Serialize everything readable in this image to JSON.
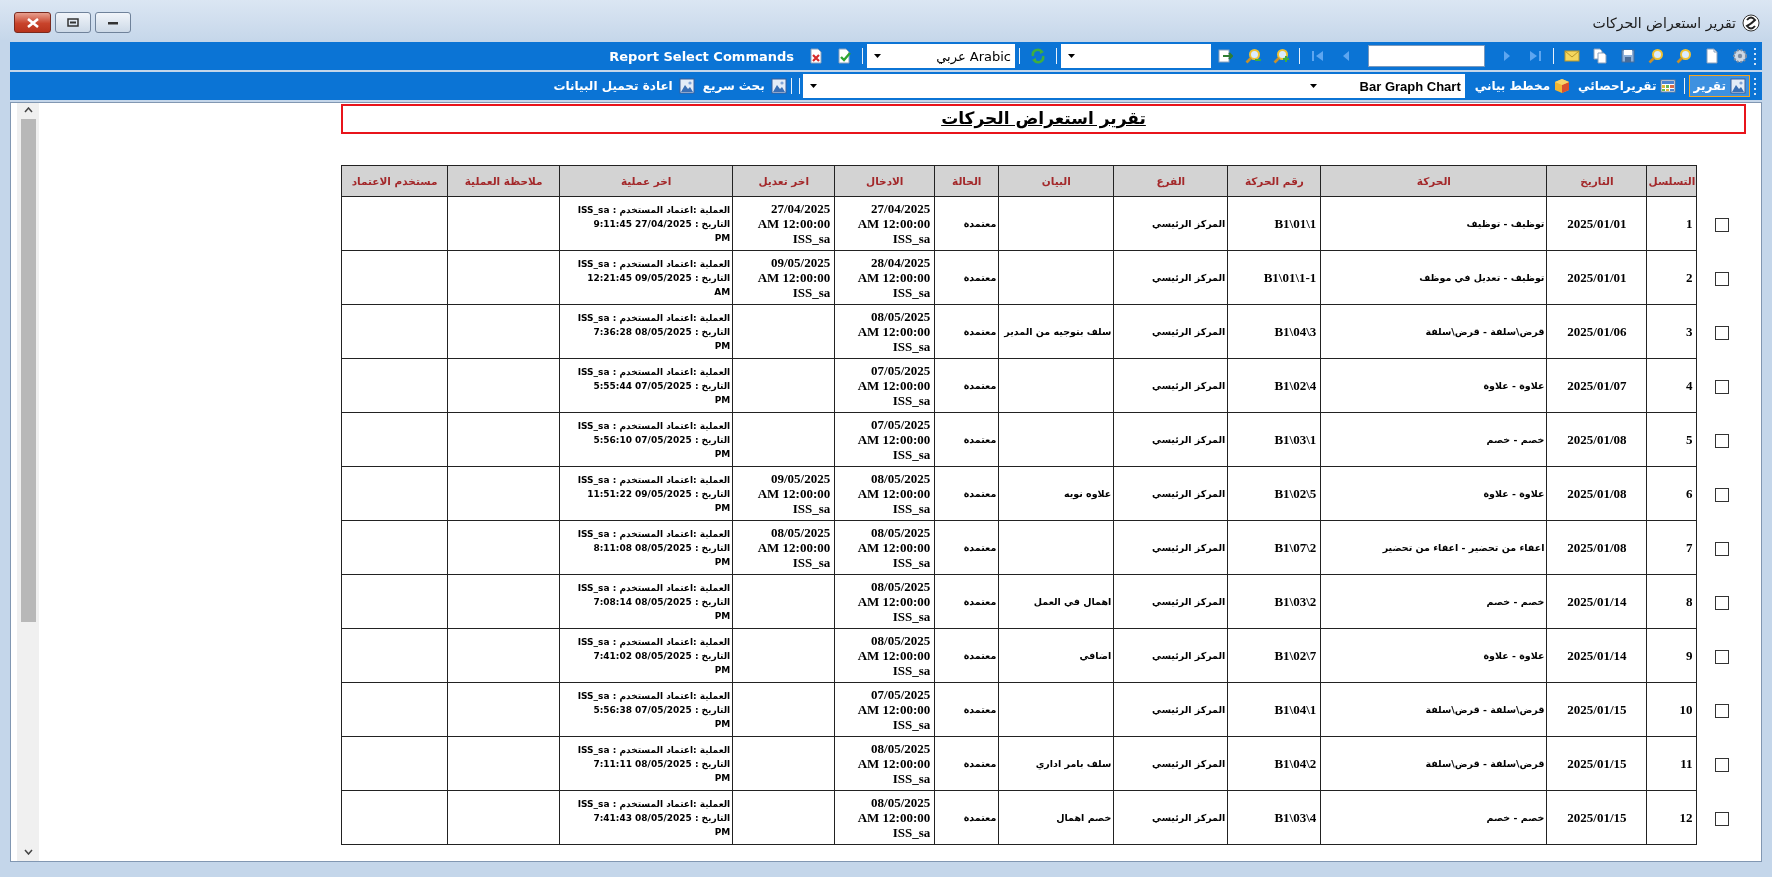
{
  "window": {
    "title": "تقرير استعراض الحركات"
  },
  "toolbar_1": {
    "label": "Report Select Commands",
    "language": "Arabic عربي"
  },
  "toolbar_2": {
    "tabs": [
      {
        "label": "تقرير",
        "selected": true
      },
      {
        "label": "تقريراحصائي",
        "selected": false
      },
      {
        "label": "مخطط بياني",
        "selected": false
      }
    ],
    "chart_type": "Bar Graph Chart",
    "actions": [
      "بحث سريع",
      "اعادة تحميل البيانات"
    ]
  },
  "report": {
    "title": "تقرير استعراض الحركات",
    "columns": [
      "التسلسل",
      "التاريخ",
      "الحركة",
      "رقم الحركة",
      "الفرع",
      "البيان",
      "الحالة",
      "الادخال",
      "اخر تعديل",
      "اخر عملية",
      "ملاحظة العملية",
      "مستخدم الاعتماد"
    ],
    "rows": [
      {
        "checked": false,
        "seq": "1",
        "date": "2025/01/01",
        "movement": "توظيف - توظيف",
        "number": "B1\\01\\1",
        "branch": "المركز الرئيسي",
        "status": "معتمدة",
        "entry": "27/04/2025\nAM 12:00:00\nISS_sa",
        "modified": "27/04/2025\nAM 12:00:00\nISS_sa",
        "last_operation": "العملية :اعتماد المستخدم : ISS_sa\nالتاريخ : 27/04/2025 9:11:45\nPM"
      },
      {
        "checked": false,
        "seq": "2",
        "date": "2025/01/01",
        "movement": "توظيف - تعديل في  موظف",
        "number": "B1\\01\\1-1",
        "branch": "المركز الرئيسي",
        "status": "معتمدة",
        "entry": "28/04/2025\nAM 12:00:00\nISS_sa",
        "modified": "09/05/2025\nAM 12:00:00\nISS_sa",
        "last_operation": "العملية :اعتماد المستخدم : ISS_sa\nالتاريخ : 09/05/2025 12:21:45\nAM"
      },
      {
        "checked": false,
        "seq": "3",
        "date": "2025/01/06",
        "movement": "قرض\\سلفة - قرض\\سلفة",
        "number": "B1\\04\\3",
        "branch": "المركز الرئيسي",
        "statement": "سلف بتوجيه من المدير",
        "status": "معتمدة",
        "entry": "08/05/2025\nAM 12:00:00\nISS_sa",
        "last_operation": "العملية :اعتماد المستخدم : ISS_sa\nالتاريخ : 08/05/2025 7:36:28\nPM"
      },
      {
        "checked": false,
        "seq": "4",
        "date": "2025/01/07",
        "movement": "علاوة - علاوة",
        "number": "B1\\02\\4",
        "branch": "المركز الرئيسي",
        "status": "معتمدة",
        "entry": "07/05/2025\nAM 12:00:00\nISS_sa",
        "last_operation": "العملية :اعتماد المستخدم : ISS_sa\nالتاريخ : 07/05/2025 5:55:44\nPM"
      },
      {
        "checked": false,
        "seq": "5",
        "date": "2025/01/08",
        "movement": "خصم - خصم",
        "number": "B1\\03\\1",
        "branch": "المركز الرئيسي",
        "status": "معتمدة",
        "entry": "07/05/2025\nAM 12:00:00\nISS_sa",
        "last_operation": "العملية :اعتماد المستخدم : ISS_sa\nالتاريخ : 07/05/2025 5:56:10\nPM"
      },
      {
        "checked": false,
        "seq": "6",
        "date": "2025/01/08",
        "movement": "علاوة - علاوة",
        "number": "B1\\02\\5",
        "branch": "المركز الرئيسي",
        "statement": "علاوه نويه",
        "status": "معتمدة",
        "entry": "08/05/2025\nAM 12:00:00\nISS_sa",
        "modified": "09/05/2025\nAM 12:00:00\nISS_sa",
        "last_operation": "العملية :اعتماد المستخدم : ISS_sa\nالتاريخ : 09/05/2025 11:51:22\nPM"
      },
      {
        "checked": false,
        "seq": "7",
        "date": "2025/01/08",
        "movement": "اعفاء من تحضير - اعفاء من تحضير",
        "number": "B1\\07\\2",
        "branch": "المركز الرئيسي",
        "status": "معتمدة",
        "entry": "08/05/2025\nAM 12:00:00\nISS_sa",
        "modified": "08/05/2025\nAM 12:00:00\nISS_sa",
        "last_operation": "العملية :اعتماد المستخدم : ISS_sa\nالتاريخ : 08/05/2025 8:11:08\nPM"
      },
      {
        "checked": false,
        "seq": "8",
        "date": "2025/01/14",
        "movement": "خصم - خصم",
        "number": "B1\\03\\2",
        "branch": "المركز الرئيسي",
        "statement": "اهمال في العمل",
        "status": "معتمدة",
        "entry": "08/05/2025\nAM 12:00:00\nISS_sa",
        "last_operation": "العملية :اعتماد المستخدم : ISS_sa\nالتاريخ : 08/05/2025 7:08:14\nPM"
      },
      {
        "checked": false,
        "seq": "9",
        "date": "2025/01/14",
        "movement": "علاوة - علاوة",
        "number": "B1\\02\\7",
        "branch": "المركز الرئيسي",
        "statement": "اضافي",
        "status": "معتمدة",
        "entry": "08/05/2025\nAM 12:00:00\nISS_sa",
        "last_operation": "العملية :اعتماد المستخدم : ISS_sa\nالتاريخ : 08/05/2025 7:41:02\nPM"
      },
      {
        "checked": false,
        "seq": "10",
        "date": "2025/01/15",
        "movement": "قرض\\سلفة - قرض\\سلفة",
        "number": "B1\\04\\1",
        "branch": "المركز الرئيسي",
        "status": "معتمدة",
        "entry": "07/05/2025\nAM 12:00:00\nISS_sa",
        "last_operation": "العملية :اعتماد المستخدم : ISS_sa\nالتاريخ : 07/05/2025 5:56:38\nPM"
      },
      {
        "checked": false,
        "seq": "11",
        "date": "2025/01/15",
        "movement": "قرض\\سلفة - قرض\\سلفة",
        "number": "B1\\04\\2",
        "branch": "المركز الرئيسي",
        "statement": "سلف بامر اداري",
        "status": "معتمدة",
        "entry": "08/05/2025\nAM 12:00:00\nISS_sa",
        "last_operation": "العملية :اعتماد المستخدم : ISS_sa\nالتاريخ : 08/05/2025 7:11:11\nPM"
      },
      {
        "checked": false,
        "seq": "12",
        "date": "2025/01/15",
        "movement": "خصم - خصم",
        "number": "B1\\03\\4",
        "branch": "المركز الرئيسي",
        "statement": "خصم اهمال",
        "status": "معتمدة",
        "entry": "08/05/2025\nAM 12:00:00\nISS_sa",
        "last_operation": "العملية :اعتماد المستخدم : ISS_sa\nالتاريخ : 08/05/2025 7:41:43\nPM"
      }
    ]
  }
}
